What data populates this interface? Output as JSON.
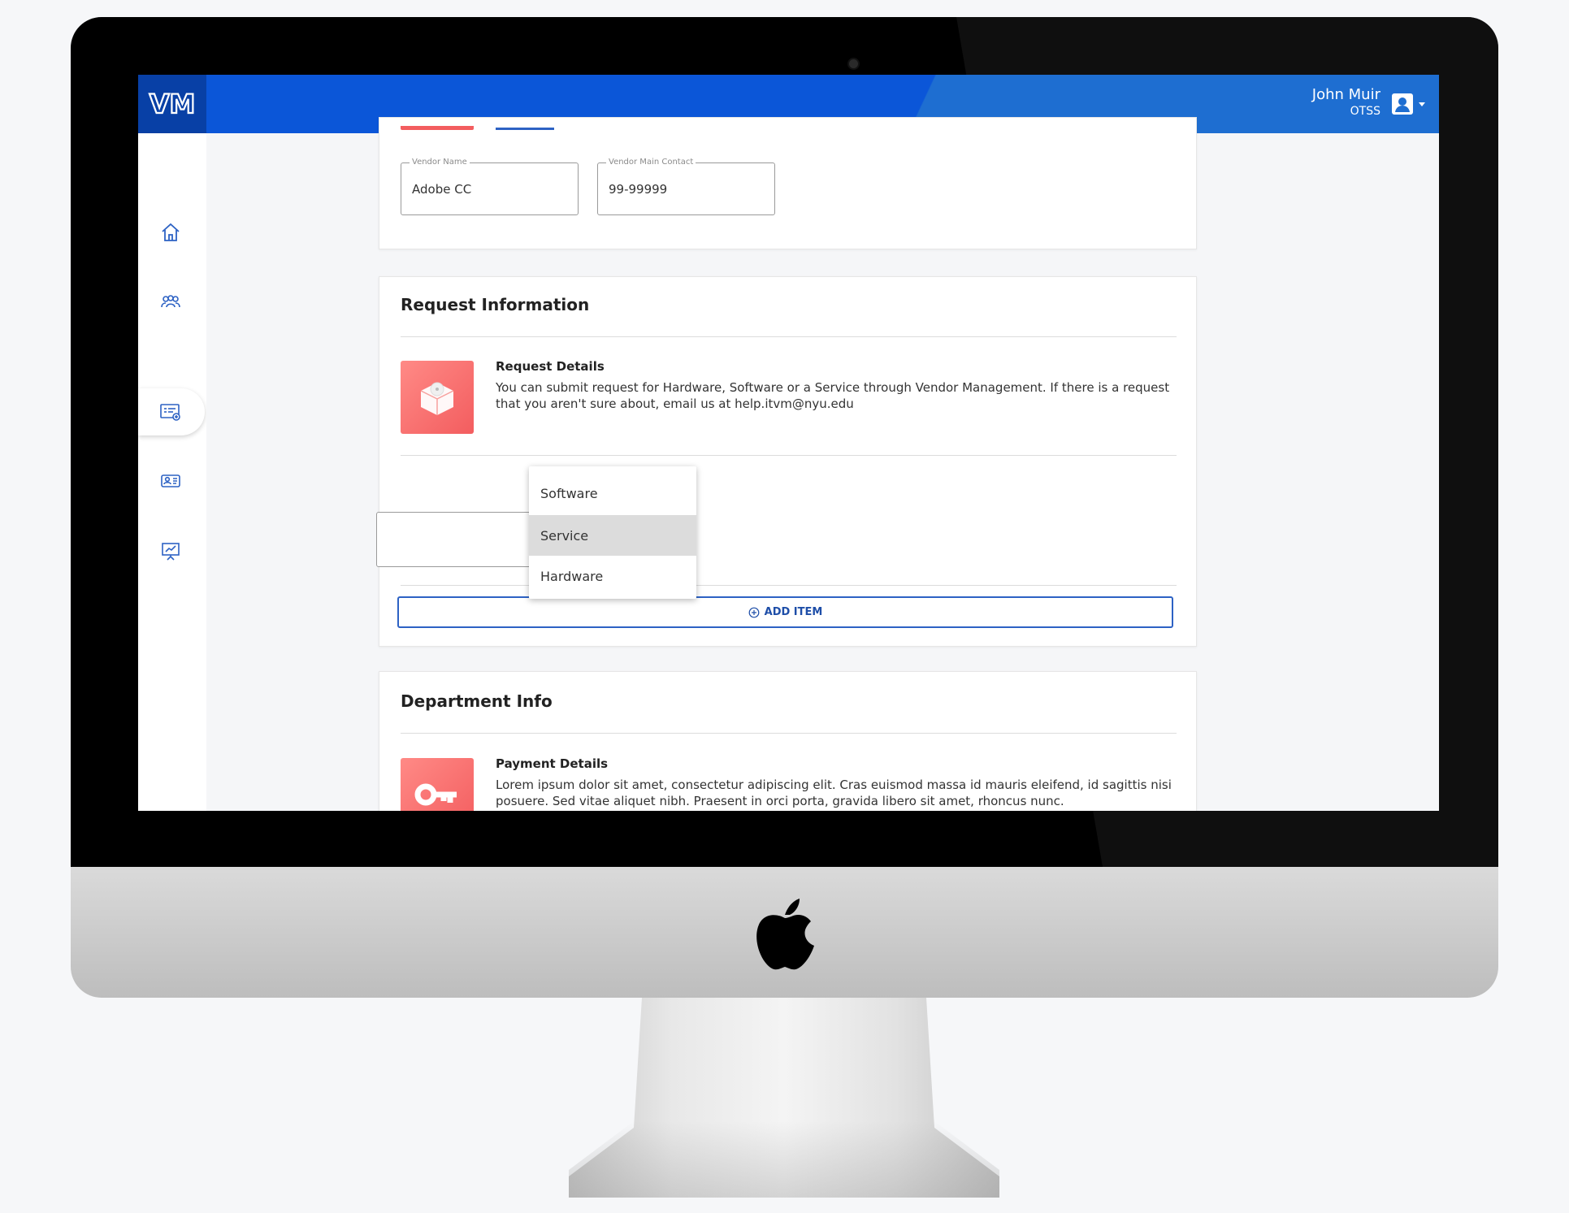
{
  "app": {
    "logo_text": "VM",
    "accent_color": "#0b56d8",
    "tile_color": "#f35d5f"
  },
  "user": {
    "name": "John Muir",
    "org": "OTSS",
    "icon": "account-box-icon"
  },
  "sidebar": {
    "items": [
      {
        "name": "home",
        "icon": "home-icon"
      },
      {
        "name": "vendors",
        "icon": "people-group-icon"
      },
      {
        "name": "requests",
        "icon": "request-form-icon",
        "active": true
      },
      {
        "name": "contacts",
        "icon": "contact-card-icon"
      },
      {
        "name": "reports",
        "icon": "presentation-chart-icon"
      }
    ]
  },
  "vendor_card": {
    "vendor_name_label": "Vendor Name",
    "vendor_name_value": "Adobe CC",
    "vendor_contact_label": "Vendor Main Contact",
    "vendor_contact_value": "99-99999"
  },
  "request_card": {
    "title": "Request Information",
    "details_heading": "Request Details",
    "details_text": "You can submit request for Hardware, Software or a Service through Vendor Management. If there is a request that you aren't sure about, email us at help.itvm@nyu.edu",
    "type_dropdown": {
      "options": [
        "Software",
        "Service",
        "Hardware"
      ],
      "highlighted": "Service"
    },
    "add_item_label": "ADD ITEM"
  },
  "department_card": {
    "title": "Department Info",
    "payment_heading": "Payment Details",
    "payment_text": "Lorem ipsum dolor sit amet, consectetur adipiscing elit. Cras euismod massa id mauris eleifend, id sagittis nisi posuere. Sed vitae aliquet nibh. Praesent in orci porta, gravida libero sit amet, rhoncus nunc."
  }
}
